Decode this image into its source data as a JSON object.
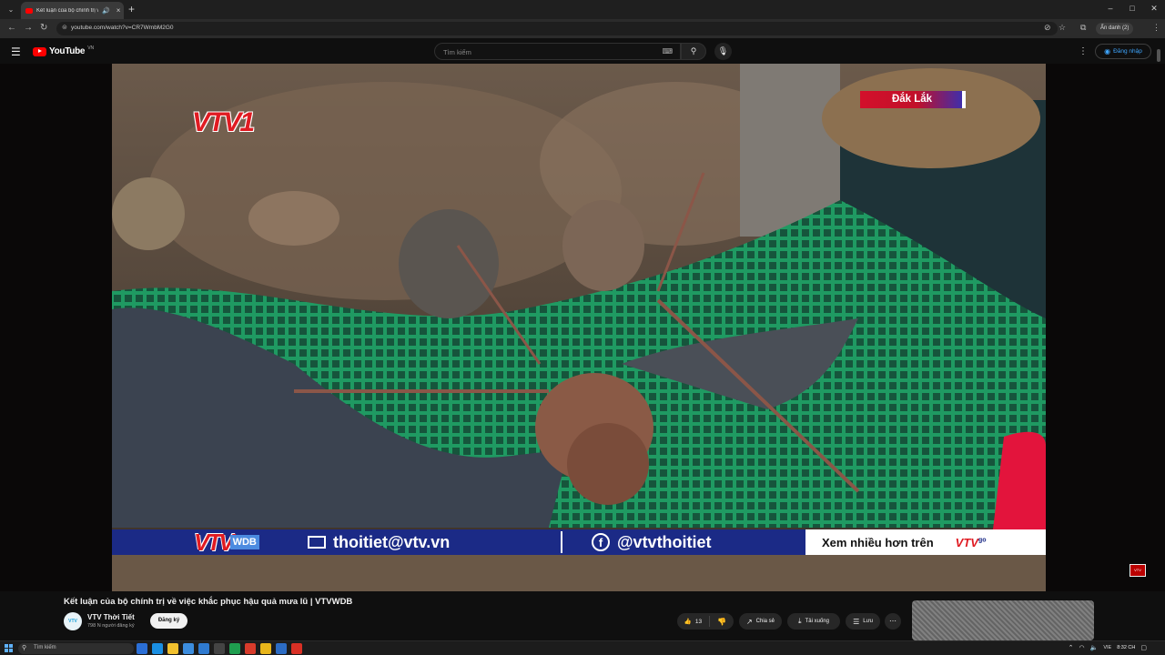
{
  "browser": {
    "tab_title": "Kết luận của bộ chính trị về",
    "url": "youtube.com/watch?v=CR7WmbM2G0",
    "profile_label": "Ẩn danh (2)"
  },
  "yt_header": {
    "brand": "YouTube",
    "country_code": "VN",
    "search_placeholder": "Tìm kiếm",
    "signin_label": "Đăng nhập"
  },
  "video": {
    "channel_logo": "VTV1",
    "location_tag": "Đắk Lắk",
    "ticker": {
      "logo_text": "VTV",
      "logo_sub": "WDB",
      "email": "thoitiet@vtv.vn",
      "facebook": "@vtvthoitiet",
      "more_text": "Xem nhiều hơn trên",
      "go_logo": "VTV",
      "go_suffix": "go"
    }
  },
  "info": {
    "title": "Kết luận của bộ chính trị về việc khắc phục hậu quả mưa lũ | VTVWDB",
    "channel_name": "VTV Thời Tiết",
    "avatar_text": "VTV",
    "subscribers": "798 N người đăng ký",
    "subscribe_label": "Đăng ký",
    "like_count": "13",
    "share_label": "Chia sẻ",
    "download_label": "Tải xuống",
    "save_label": "Lưu"
  },
  "taskbar": {
    "search_placeholder": "Tìm kiếm",
    "lang": "VIE",
    "time": "8:32 CH"
  },
  "colors": {
    "yt_red": "#ff0000",
    "vtv_red": "#e01b22",
    "ticker_blue": "#1b2a86"
  }
}
